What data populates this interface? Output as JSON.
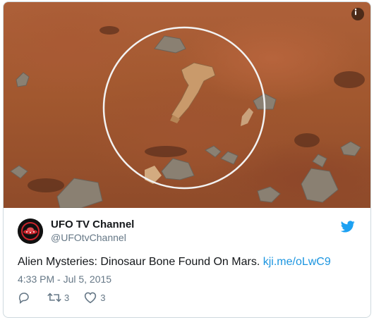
{
  "media": {
    "alt": "Mars surface photo with circled bone-shaped rock",
    "info_icon": "info-icon"
  },
  "user": {
    "display_name": "UFO TV Channel",
    "handle": "@UFOtvChannel",
    "avatar_icon": "ufo-logo-avatar"
  },
  "brand": {
    "icon": "twitter-bird-icon",
    "color": "#1da1f2"
  },
  "tweet": {
    "text": "Alien Mysteries: Dinosaur Bone Found On Mars.",
    "link": "kji.me/oLwC9",
    "link_color": "#1b95e0",
    "timestamp": "4:33 PM - Jul 5, 2015"
  },
  "actions": {
    "reply_icon": "reply-icon",
    "retweet_icon": "retweet-icon",
    "retweet_count": "3",
    "like_icon": "heart-icon",
    "like_count": "3"
  }
}
